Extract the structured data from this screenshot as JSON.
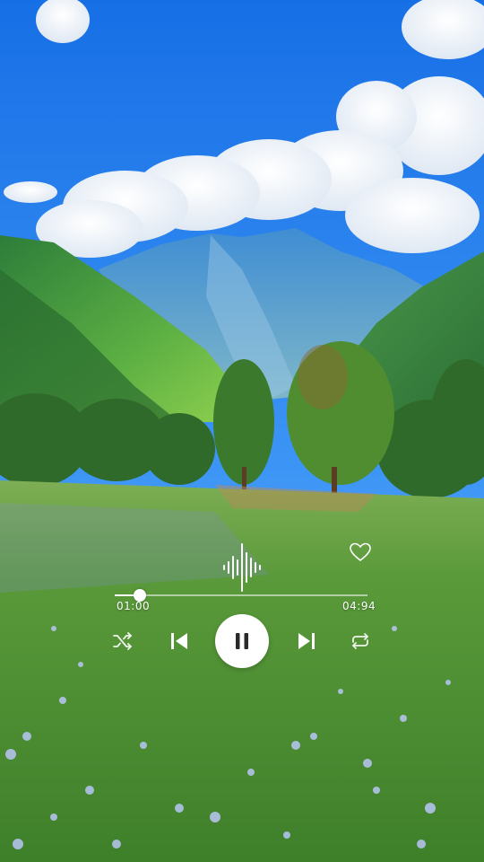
{
  "player": {
    "elapsed": "01:00",
    "total": "04:94",
    "progress_fraction": 0.1,
    "liked": false
  },
  "icons": {
    "waveform": "waveform-icon",
    "like": "heart-icon",
    "shuffle": "shuffle-icon",
    "previous": "skip-previous-icon",
    "pause": "pause-icon",
    "next": "skip-next-icon",
    "repeat": "repeat-icon"
  },
  "colors": {
    "sky_top": "#1f74e8",
    "sky_bottom": "#4fa6ff",
    "mountain": "#3c8ad0",
    "hill_green": "#3e9a3c",
    "meadow": "#5e9e38",
    "controls": "#ffffff",
    "pause_icon": "#2a2a2a"
  }
}
